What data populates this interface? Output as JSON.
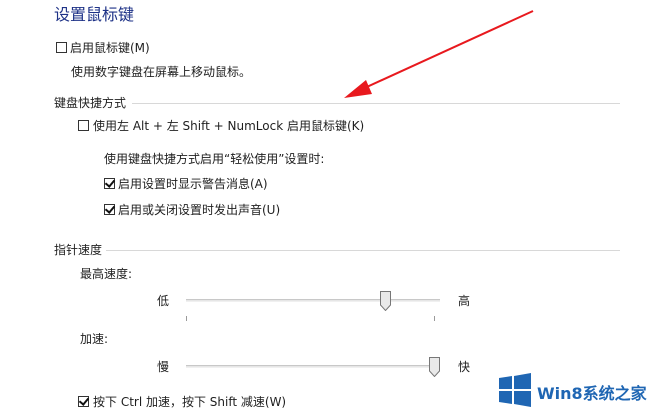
{
  "title": "设置鼠标键",
  "enable_mousekeys": {
    "label": "启用鼠标键(M)",
    "checked": false
  },
  "enable_desc": "使用数字键盘在屏幕上移动鼠标。",
  "shortcut_section": {
    "title": "键盘快捷方式",
    "alt_shift_numlock": {
      "label": "使用左 Alt + 左 Shift + NumLock 启用鼠标键(K)",
      "checked": false
    },
    "ease_heading": "使用键盘快捷方式启用“轻松使用”设置时:",
    "show_warning": {
      "label": "启用设置时显示警告消息(A)",
      "checked": true
    },
    "play_sound": {
      "label": "启用或关闭设置时发出声音(U)",
      "checked": true
    }
  },
  "pointer_section": {
    "title": "指针速度",
    "top_speed": {
      "label": "最高速度:",
      "low": "低",
      "high": "高",
      "value": 0.8
    },
    "acceleration": {
      "label": "加速:",
      "low": "慢",
      "high": "快",
      "value": 1.0
    },
    "ctrl_shift": {
      "label": "按下 Ctrl 加速，按下 Shift 减速(W)",
      "checked": true
    }
  },
  "watermark": {
    "text": "Win8系统之家",
    "icon": "windows-logo-icon",
    "color": "#1f66b3"
  },
  "annotation": {
    "icon": "red-arrow-icon",
    "color": "#e8191e"
  }
}
